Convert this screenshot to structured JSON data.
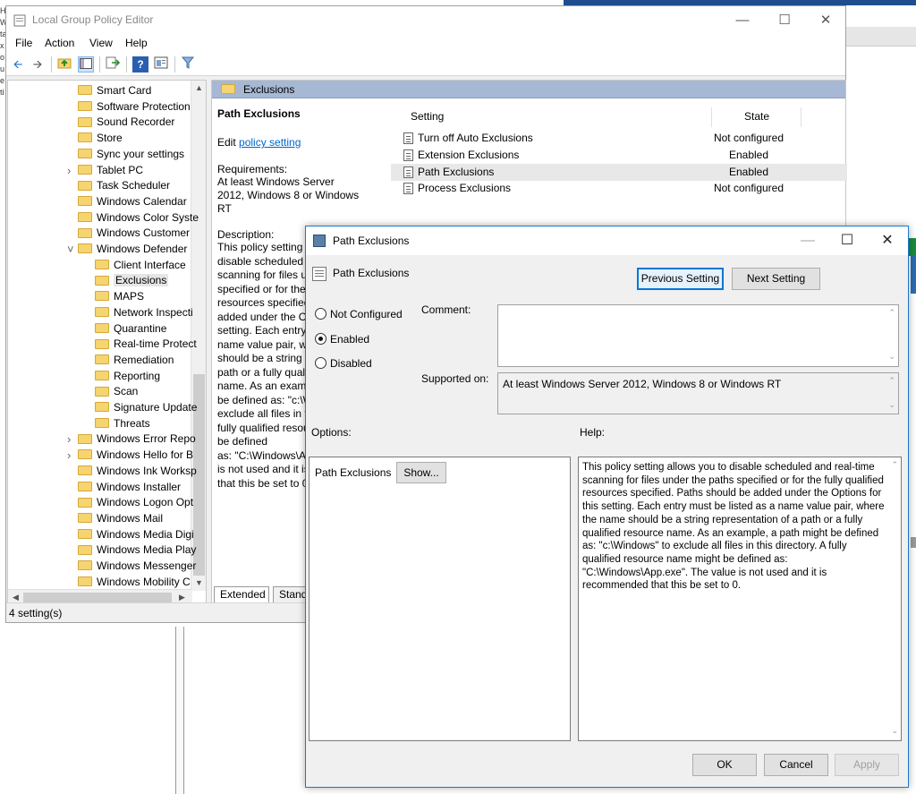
{
  "window": {
    "title": "Local Group Policy Editor",
    "menu": [
      "File",
      "Action",
      "View",
      "Help"
    ],
    "status": "4 setting(s)"
  },
  "tree": {
    "items": [
      {
        "label": "Smart Card",
        "expander": ""
      },
      {
        "label": "Software Protection",
        "expander": ""
      },
      {
        "label": "Sound Recorder",
        "expander": ""
      },
      {
        "label": "Store",
        "expander": ""
      },
      {
        "label": "Sync your settings",
        "expander": ""
      },
      {
        "label": "Tablet PC",
        "expander": ">"
      },
      {
        "label": "Task Scheduler",
        "expander": ""
      },
      {
        "label": "Windows Calendar",
        "expander": ""
      },
      {
        "label": "Windows Color Syste",
        "expander": ""
      },
      {
        "label": "Windows Customer",
        "expander": ""
      },
      {
        "label": "Windows Defender",
        "expander": "v"
      },
      {
        "label": "Client Interface",
        "expander": ""
      },
      {
        "label": "Exclusions",
        "expander": ""
      },
      {
        "label": "MAPS",
        "expander": ""
      },
      {
        "label": "Network Inspecti",
        "expander": ""
      },
      {
        "label": "Quarantine",
        "expander": ""
      },
      {
        "label": "Real-time Protect",
        "expander": ""
      },
      {
        "label": "Remediation",
        "expander": ""
      },
      {
        "label": "Reporting",
        "expander": ""
      },
      {
        "label": "Scan",
        "expander": ""
      },
      {
        "label": "Signature Update",
        "expander": ""
      },
      {
        "label": "Threats",
        "expander": ""
      },
      {
        "label": "Windows Error Repo",
        "expander": ">"
      },
      {
        "label": "Windows Hello for B",
        "expander": ">"
      },
      {
        "label": "Windows Ink Worksp",
        "expander": ""
      },
      {
        "label": "Windows Installer",
        "expander": ""
      },
      {
        "label": "Windows Logon Opt",
        "expander": ""
      },
      {
        "label": "Windows Mail",
        "expander": ""
      },
      {
        "label": "Windows Media Digi",
        "expander": ""
      },
      {
        "label": "Windows Media Play",
        "expander": ""
      },
      {
        "label": "Windows Messenger",
        "expander": ""
      },
      {
        "label": "Windows Mobility C",
        "expander": ""
      }
    ]
  },
  "content": {
    "header": "Exclusions",
    "extended": {
      "title": "Path Exclusions",
      "edit_prefix": "Edit ",
      "edit_link": "policy setting",
      "req_label": "Requirements:",
      "req_text": "At least Windows Server 2012, Windows 8 or Windows RT",
      "desc_label": "Description:",
      "desc_lines": [
        "This policy setting a",
        "disable scheduled a",
        "scanning for files u",
        "specified or for the",
        "resources specified",
        "added under the Op",
        "setting. Each entry",
        "name value pair, wh",
        "should be a string r",
        "path or a fully quali",
        "name. As an examp",
        "be defined as: \"c:\\W",
        "exclude all files in th",
        "fully qualified resou",
        "be defined",
        "as: \"C:\\Windows\\A",
        "is not used and it is",
        "that this be set to 0"
      ]
    },
    "columns": {
      "setting": "Setting",
      "state": "State"
    },
    "rows": [
      {
        "name": "Turn off Auto Exclusions",
        "state": "Not configured"
      },
      {
        "name": "Extension Exclusions",
        "state": "Enabled"
      },
      {
        "name": "Path Exclusions",
        "state": "Enabled"
      },
      {
        "name": "Process Exclusions",
        "state": "Not configured"
      }
    ],
    "tabs": [
      "Extended",
      "Standa"
    ]
  },
  "dialog": {
    "title": "Path Exclusions",
    "subtitle": "Path Exclusions",
    "prev_button": "Previous Setting",
    "next_button": "Next Setting",
    "radio_not_configured": "Not Configured",
    "radio_enabled": "Enabled",
    "radio_disabled": "Disabled",
    "comment_label": "Comment:",
    "supported_label": "Supported on:",
    "supported_value": "At least Windows Server 2012, Windows 8 or Windows RT",
    "options_label": "Options:",
    "help_label": "Help:",
    "option_item_label": "Path Exclusions",
    "show_button": "Show...",
    "help_text": "This policy setting allows you to disable scheduled and real-time scanning for files under the paths specified or for the fully qualified resources specified. Paths should be added under the Options for this setting. Each entry must be listed as a name value pair, where the name should be a string representation of a path or a fully qualified resource name. As an example, a path might be defined as: \"c:\\Windows\" to exclude all files in this directory. A fully qualified resource name might be defined as: \"C:\\Windows\\App.exe\". The value is not used and it is recommended that this be set to 0.",
    "ok": "OK",
    "cancel": "Cancel",
    "apply": "Apply"
  },
  "background": {
    "left_letters": [
      "H",
      "W",
      "ta",
      "x",
      "o",
      "u",
      "e",
      "ti"
    ]
  },
  "colors": {
    "header_bar": "#a6b8d3",
    "dialog_border": "#1979ca",
    "link": "#0066cc",
    "focus_button": "#0078d7"
  }
}
